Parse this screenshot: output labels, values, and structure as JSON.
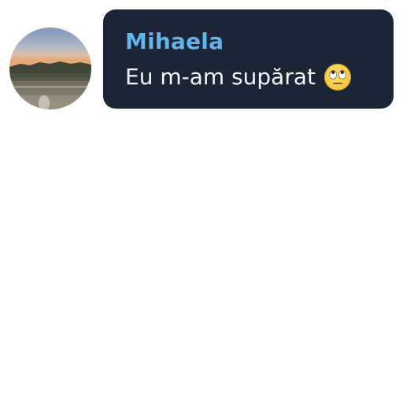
{
  "message": {
    "sender_name": "Mihaela",
    "text": "Eu m-am supărat",
    "emoji": "face-with-rolling-eyes-icon",
    "avatar": "profile-photo-landscape",
    "colors": {
      "bubble_background": "#1b2535",
      "sender_name": "#63b3ed",
      "message_text": "#f5f7fa"
    }
  }
}
